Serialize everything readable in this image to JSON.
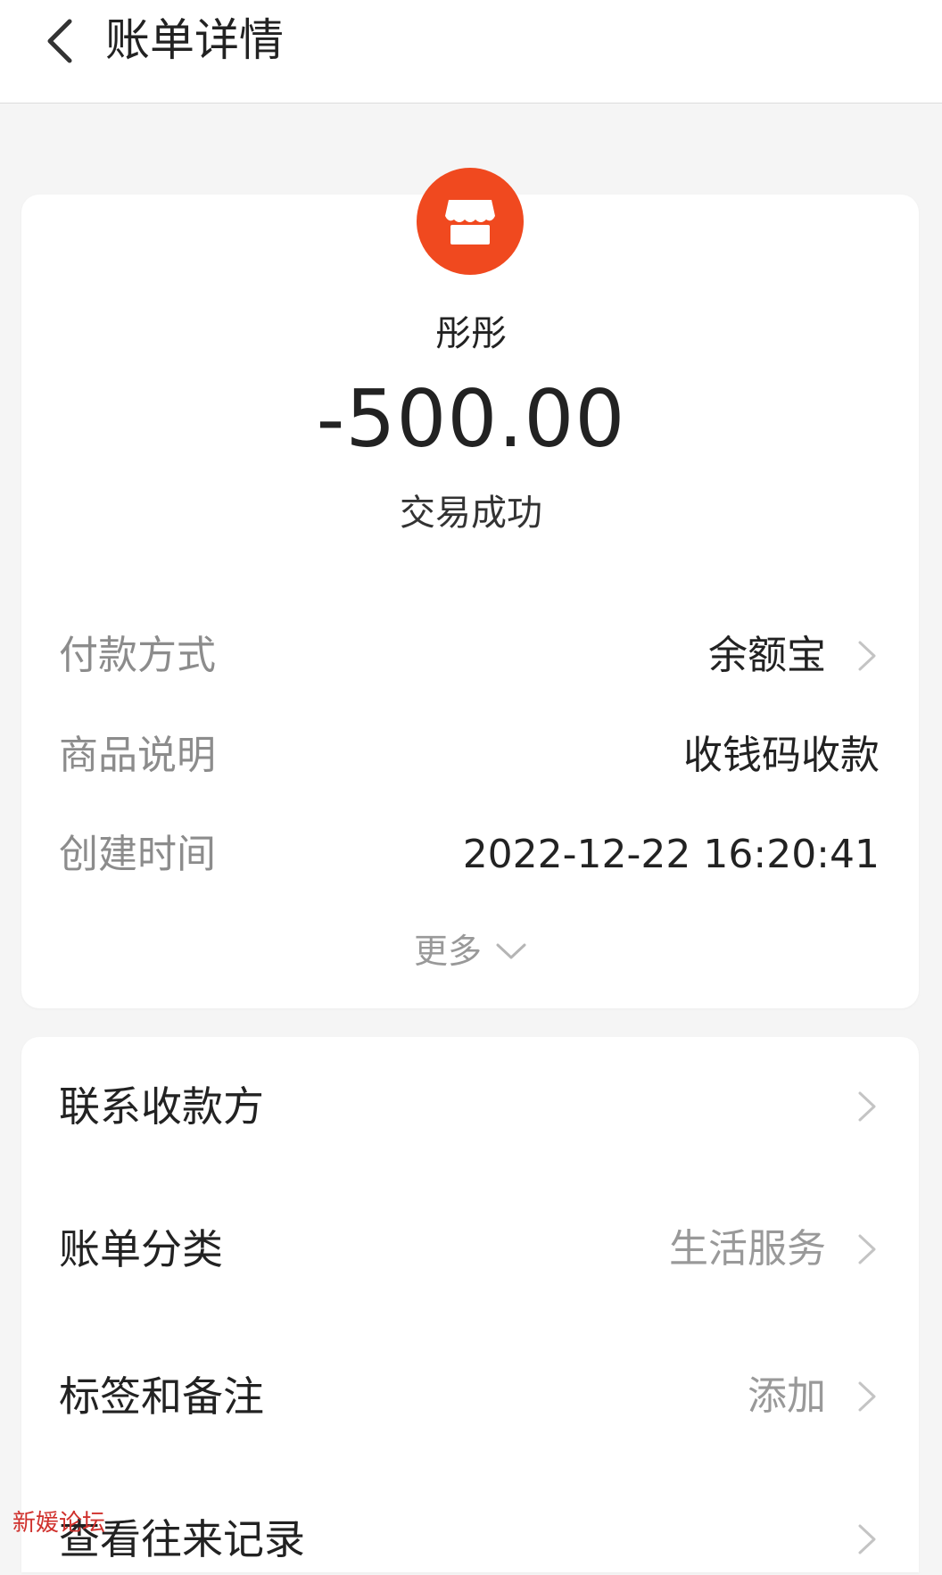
{
  "header": {
    "title": "账单详情"
  },
  "merchant": {
    "name": "彤彤",
    "icon": "store-icon"
  },
  "amount": "-500.00",
  "status": "交易成功",
  "details": {
    "payment_method": {
      "label": "付款方式",
      "value": "余额宝"
    },
    "product_desc": {
      "label": "商品说明",
      "value": "收钱码收款"
    },
    "created_time": {
      "label": "创建时间",
      "value": "2022-12-22 16:20:41"
    }
  },
  "more_label": "更多",
  "actions": [
    {
      "title": "联系收款方",
      "value": ""
    },
    {
      "title": "账单分类",
      "value": "生活服务"
    },
    {
      "title": "标签和备注",
      "value": "添加"
    },
    {
      "title": "查看往来记录",
      "value": ""
    }
  ],
  "watermark": "新媛论坛",
  "colors": {
    "accent": "#f0491f",
    "muted": "#8c8c8c",
    "text": "#222222"
  }
}
